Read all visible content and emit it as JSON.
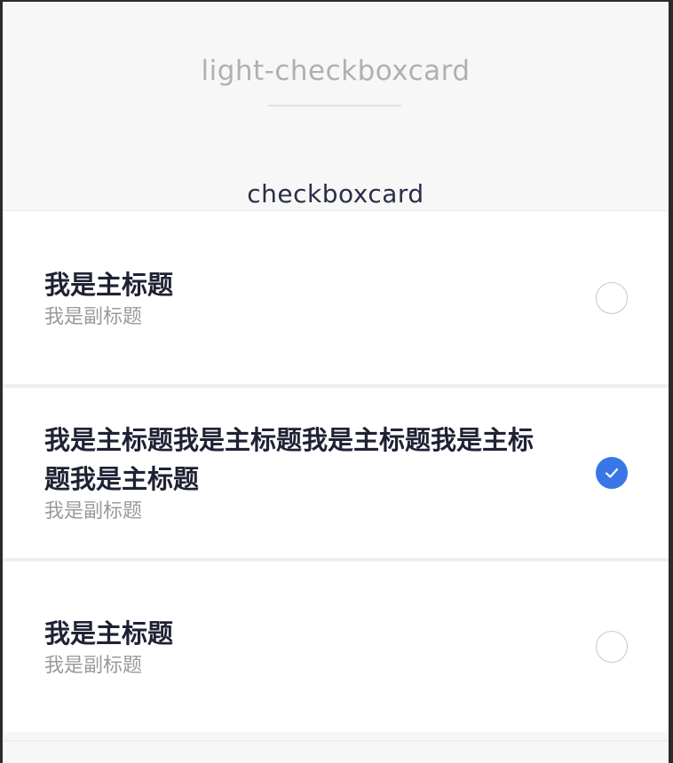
{
  "header": {
    "title": "light-checkboxcard",
    "section_title": "checkboxcard"
  },
  "cards": [
    {
      "title": "我是主标题",
      "subtitle": "我是副标题",
      "checked": false
    },
    {
      "title": "我是主标题我是主标题我是主标题我是主标题我是主标题",
      "subtitle": "我是副标题",
      "checked": true
    },
    {
      "title": "我是主标题",
      "subtitle": "我是副标题",
      "checked": false
    }
  ],
  "colors": {
    "accent": "#3a77e6",
    "title_text": "#1f2233",
    "subtitle_text": "#9a9a9a"
  },
  "icons": {
    "checked": "checkmark-icon"
  }
}
